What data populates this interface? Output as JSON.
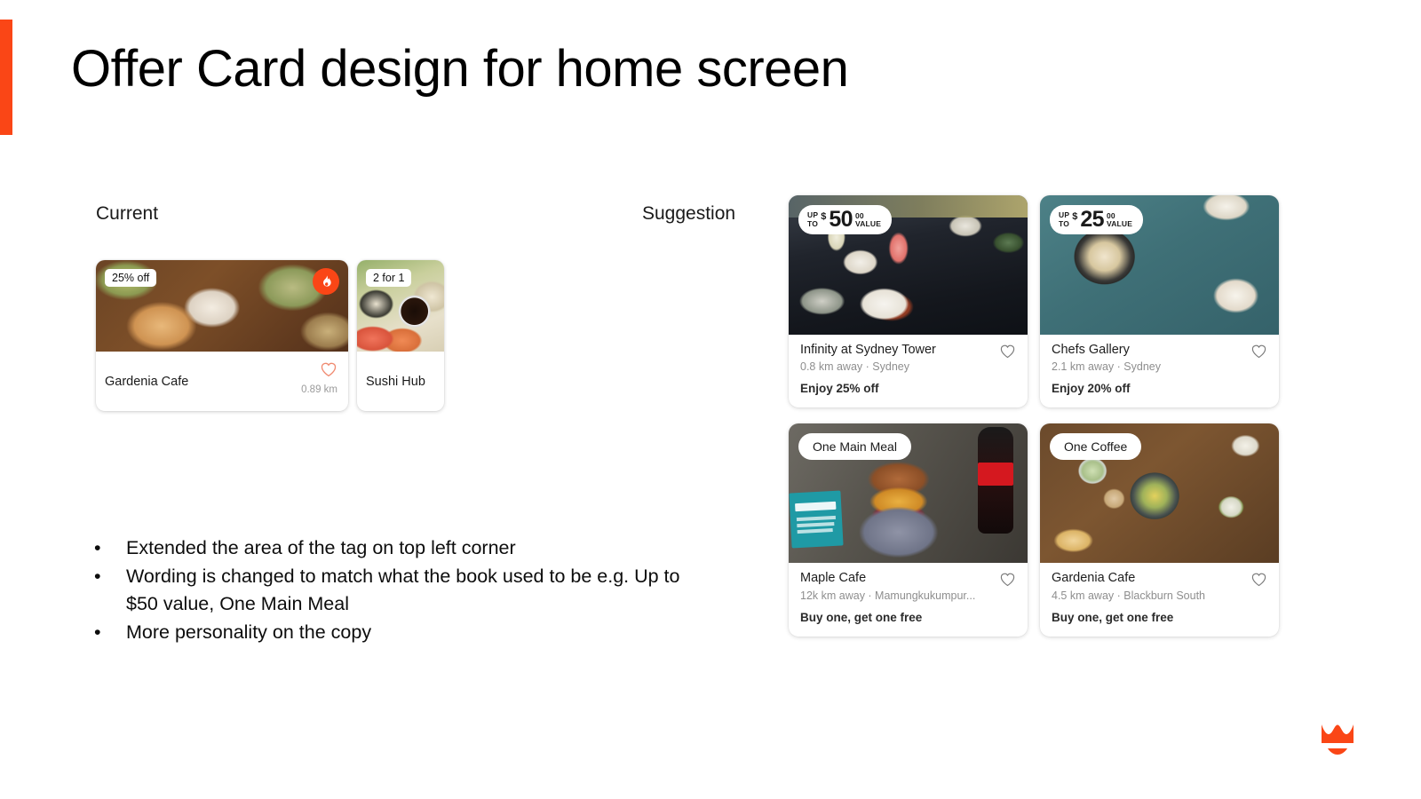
{
  "slide": {
    "title": "Offer Card design for home screen",
    "accent_color": "#FA4616"
  },
  "columns": {
    "current_label": "Current",
    "suggestion_label": "Suggestion"
  },
  "current_cards": [
    {
      "tag": "25% off",
      "badge_icon": "flame-icon",
      "name": "Gardenia Cafe",
      "distance": "0.89 km",
      "heart_icon": "heart-outline-icon"
    },
    {
      "tag": "2 for 1",
      "name": "Sushi Hub"
    }
  ],
  "suggestion_cards": [
    {
      "badge_type": "value",
      "badge_up": "UP",
      "badge_to": "TO",
      "badge_currency": "$",
      "badge_amount": "50",
      "badge_cents": "00",
      "badge_value": "VALUE",
      "name": "Infinity at Sydney Tower",
      "meta": "0.8 km away · Sydney",
      "offer": "Enjoy 25% off",
      "heart_icon": "heart-outline-icon"
    },
    {
      "badge_type": "value",
      "badge_up": "UP",
      "badge_to": "TO",
      "badge_currency": "$",
      "badge_amount": "25",
      "badge_cents": "00",
      "badge_value": "VALUE",
      "name": "Chefs Gallery",
      "meta": "2.1 km away · Sydney",
      "offer": "Enjoy 20% off",
      "heart_icon": "heart-outline-icon"
    },
    {
      "badge_type": "text",
      "badge_text": "One Main Meal",
      "name": "Maple Cafe",
      "meta": "12k km away · Mamungkukumpur...",
      "offer": "Buy one, get one free",
      "heart_icon": "heart-outline-icon"
    },
    {
      "badge_type": "text",
      "badge_text": "One Coffee",
      "name": "Gardenia Cafe",
      "meta": "4.5 km away · Blackburn South",
      "offer": "Buy one, get one free",
      "heart_icon": "heart-outline-icon"
    }
  ],
  "notes": [
    "Extended the area of the tag on top left corner",
    "Wording is changed to match what the book used to be e.g. Up to $50 value, One Main Meal",
    "More personality on the copy"
  ],
  "logo": {
    "icon": "crown-icon",
    "color": "#FA4616"
  }
}
